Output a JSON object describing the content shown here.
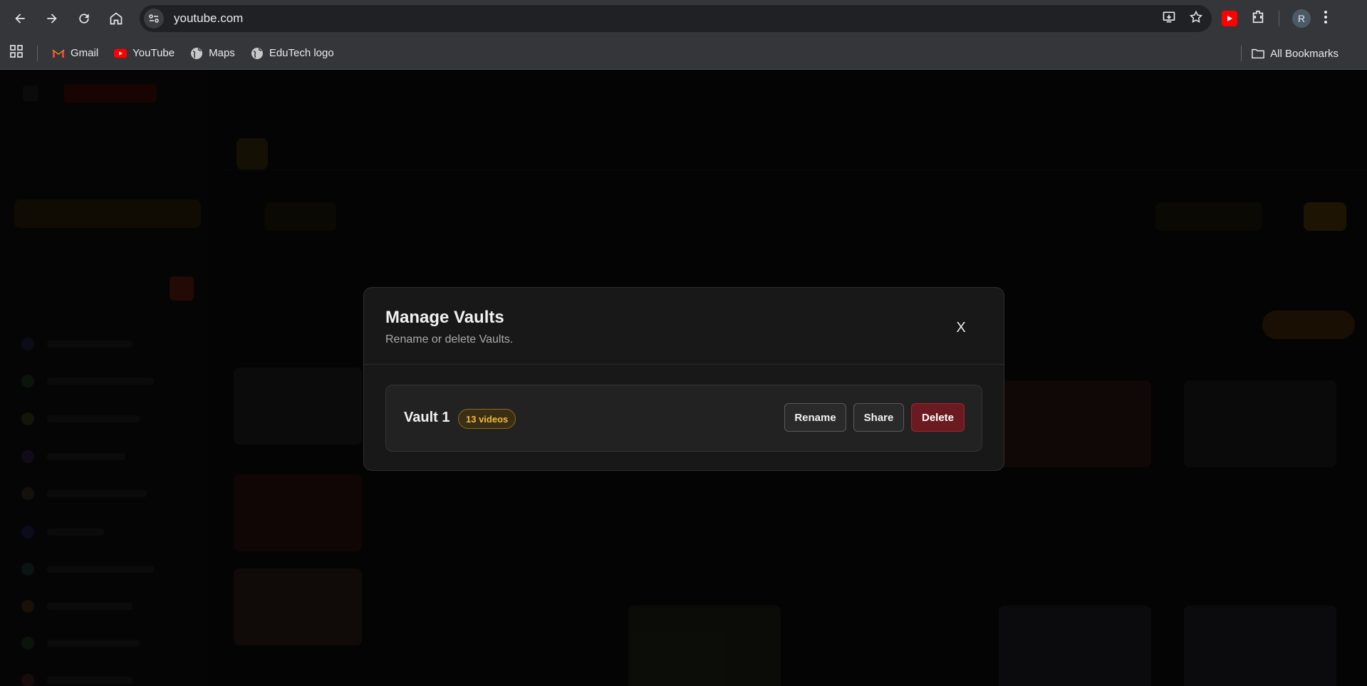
{
  "browser": {
    "url": "youtube.com",
    "profile_initial": "R",
    "bookmarks": [
      {
        "label": "Gmail",
        "icon": "gmail-icon"
      },
      {
        "label": "YouTube",
        "icon": "youtube-icon"
      },
      {
        "label": "Maps",
        "icon": "globe-icon"
      },
      {
        "label": "EduTech logo",
        "icon": "globe-icon"
      }
    ],
    "all_bookmarks_label": "All Bookmarks"
  },
  "modal": {
    "title": "Manage Vaults",
    "subtitle": "Rename or delete Vaults.",
    "close_label": "X",
    "vaults": [
      {
        "name": "Vault 1",
        "count_label": "13 videos"
      }
    ],
    "rename_label": "Rename",
    "share_label": "Share",
    "delete_label": "Delete"
  },
  "colors": {
    "accent": "#f5b941",
    "delete": "#6b1a1f",
    "brand_red": "#ff0000"
  }
}
